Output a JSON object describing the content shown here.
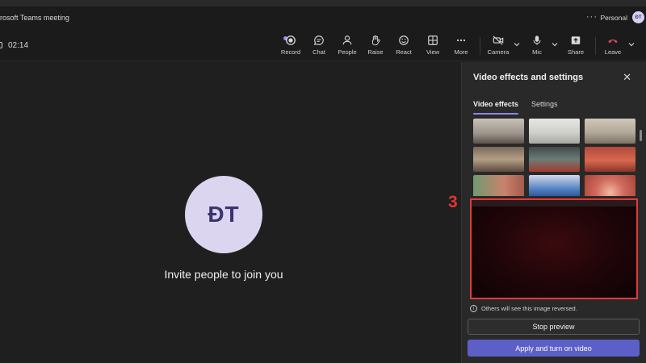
{
  "window": {
    "title": "rosoft Teams meeting",
    "more_label": "···",
    "account": "Personal",
    "account_initials": "ĐT"
  },
  "toolbar": {
    "timer": "02:14",
    "buttons": [
      {
        "label": "Record",
        "icon": "record-icon"
      },
      {
        "label": "Chat",
        "icon": "chat-icon"
      },
      {
        "label": "People",
        "icon": "people-icon"
      },
      {
        "label": "Raise",
        "icon": "raise-hand-icon"
      },
      {
        "label": "React",
        "icon": "react-icon"
      },
      {
        "label": "View",
        "icon": "view-icon"
      },
      {
        "label": "More",
        "icon": "more-icon"
      },
      {
        "label": "Camera",
        "icon": "camera-off-icon"
      },
      {
        "label": "Mic",
        "icon": "mic-icon"
      },
      {
        "label": "Share",
        "icon": "share-icon"
      },
      {
        "label": "Leave",
        "icon": "leave-icon"
      }
    ]
  },
  "stage": {
    "initials": "ĐT",
    "invite_text": "Invite people to join you"
  },
  "panel": {
    "title": "Video effects and settings",
    "close": "✕",
    "tabs": [
      {
        "label": "Video effects",
        "active": true
      },
      {
        "label": "Settings",
        "active": false
      }
    ],
    "note": "Others will see this image reversed.",
    "stop_preview": "Stop preview",
    "apply": "Apply and turn on video"
  },
  "annotation": {
    "step_number": "3",
    "color": "#e53333"
  },
  "colors": {
    "accent": "#5b5fc7",
    "tab_underline": "#8a86e6",
    "highlight_border": "#e43a3a",
    "leave_red": "#e05050"
  }
}
